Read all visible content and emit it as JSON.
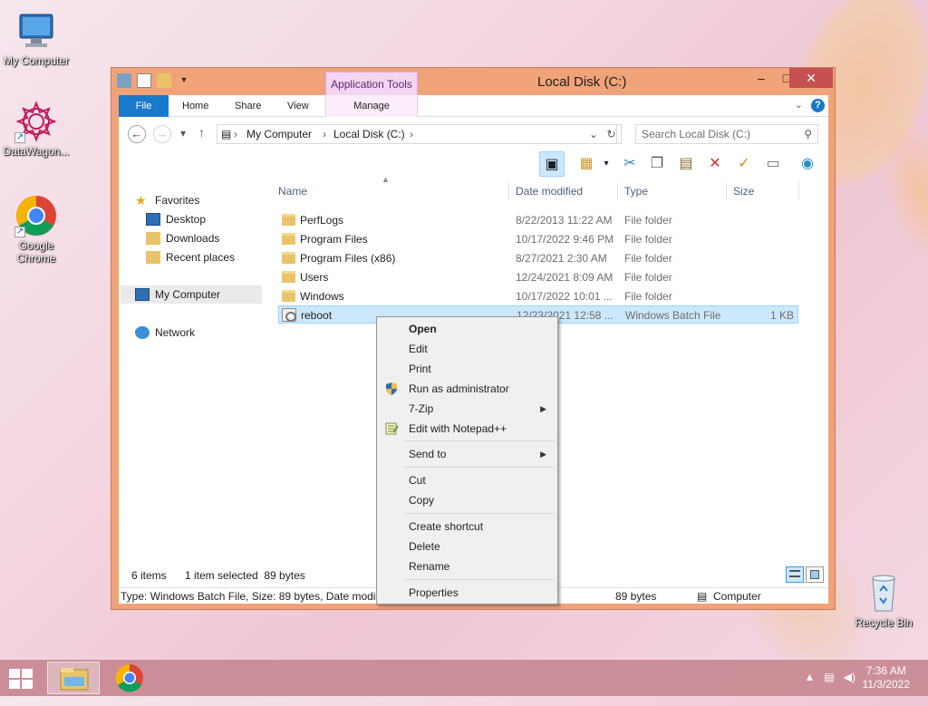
{
  "desktop": {
    "icons": [
      {
        "label": "My Computer"
      },
      {
        "label": "DataWagon..."
      },
      {
        "label": "Google Chrome"
      },
      {
        "label": "Recycle Bin"
      }
    ]
  },
  "window": {
    "title": "Local Disk (C:)",
    "contextual_tab_group": "Application Tools",
    "ribbon_tabs": [
      "File",
      "Home",
      "Share",
      "View",
      "Manage"
    ],
    "help": "?",
    "address": {
      "segments": [
        "My Computer",
        "Local Disk (C:)"
      ],
      "search_placeholder": "Search Local Disk (C:)"
    },
    "nav": {
      "favorites": "Favorites",
      "favorites_items": [
        "Desktop",
        "Downloads",
        "Recent places"
      ],
      "my_computer": "My Computer",
      "network": "Network"
    },
    "columns": [
      "Name",
      "Date modified",
      "Type",
      "Size"
    ],
    "rows": [
      {
        "name": "PerfLogs",
        "date": "8/22/2013 11:22 AM",
        "type": "File folder",
        "size": "",
        "kind": "folder"
      },
      {
        "name": "Program Files",
        "date": "10/17/2022 9:46 PM",
        "type": "File folder",
        "size": "",
        "kind": "folder"
      },
      {
        "name": "Program Files (x86)",
        "date": "8/27/2021 2:30 AM",
        "type": "File folder",
        "size": "",
        "kind": "folder"
      },
      {
        "name": "Users",
        "date": "12/24/2021 8:09 AM",
        "type": "File folder",
        "size": "",
        "kind": "folder"
      },
      {
        "name": "Windows",
        "date": "10/17/2022 10:01 ...",
        "type": "File folder",
        "size": "",
        "kind": "folder"
      },
      {
        "name": "reboot",
        "date": "12/23/2021 12:58 ...",
        "type": "Windows Batch File",
        "size": "1 KB",
        "kind": "bat"
      }
    ],
    "status": {
      "item_count": "6 items",
      "selection": "1 item selected  89 bytes",
      "details": "Type: Windows Batch File, Size: 89 bytes, Date modifie",
      "size": "89 bytes",
      "location": "Computer"
    }
  },
  "context_menu": {
    "items": [
      {
        "label": "Open"
      },
      {
        "label": "Edit"
      },
      {
        "label": "Print"
      },
      {
        "label": "Run as administrator"
      },
      {
        "label": "7-Zip"
      },
      {
        "label": "Edit with Notepad++"
      },
      {
        "label": "Send to"
      },
      {
        "label": "Cut"
      },
      {
        "label": "Copy"
      },
      {
        "label": "Create shortcut"
      },
      {
        "label": "Delete"
      },
      {
        "label": "Rename"
      },
      {
        "label": "Properties"
      }
    ]
  },
  "taskbar": {
    "time": "7:36 AM",
    "date": "11/3/2022"
  },
  "colors": {
    "title_bar": "#f0a379",
    "file_tab": "#1979ca",
    "selection": "#cce8ff",
    "taskbar": "#c4828c"
  }
}
